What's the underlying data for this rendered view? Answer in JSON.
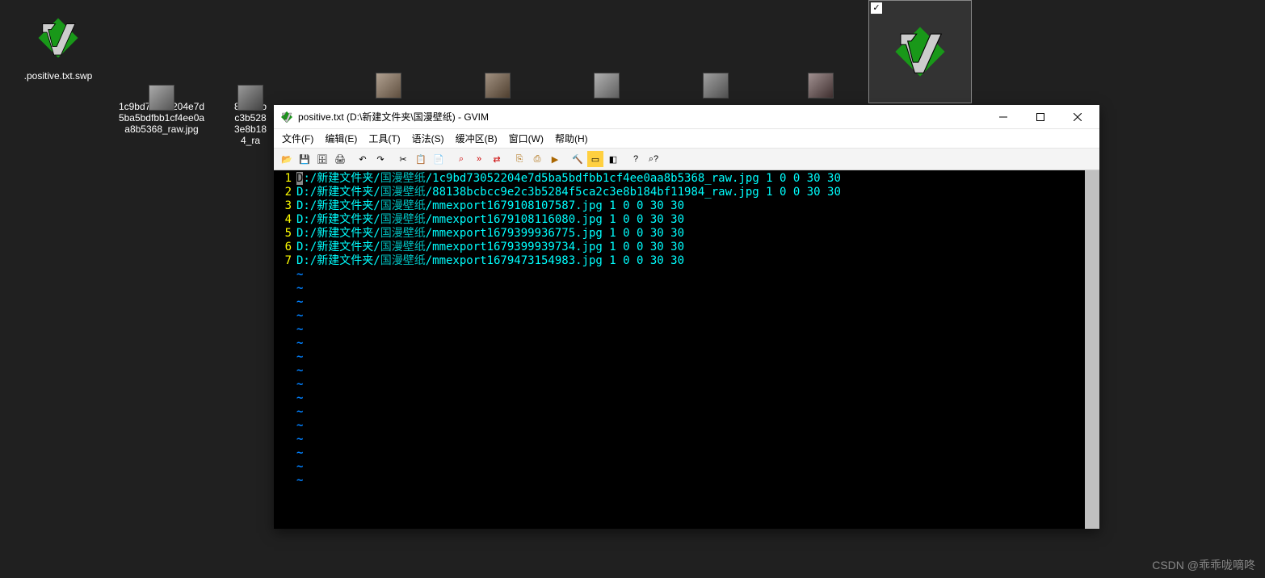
{
  "desktop": {
    "swp_file": ".positive.txt.swp",
    "file1": "1c9bd73052204e7d5ba5bdfbb1cf4ee0aa8b5368_raw.jpg",
    "file2_partial": "88138b\nc3b528\n3e8b18\n4_ra"
  },
  "gvim": {
    "title": "positive.txt (D:\\新建文件夹\\国漫壁纸) - GVIM",
    "menu": {
      "file": "文件(F)",
      "edit": "编辑(E)",
      "tools": "工具(T)",
      "syntax": "语法(S)",
      "buffers": "缓冲区(B)",
      "window": "窗口(W)",
      "help": "帮助(H)"
    },
    "lines": [
      {
        "n": "1",
        "p1": ":/新建文件夹/",
        "p2": "国漫壁纸",
        "p3": "/1c9bd73052204e7d5ba5bdfbb1cf4ee0aa8b5368_raw.jpg 1 0 0 30 30"
      },
      {
        "n": "2",
        "p1": "D:/新建文件夹/",
        "p2": "国漫壁纸",
        "p3": "/88138bcbcc9e2c3b5284f5ca2c3e8b184bf11984_raw.jpg 1 0 0 30 30"
      },
      {
        "n": "3",
        "p1": "D:/新建文件夹/",
        "p2": "国漫壁纸",
        "p3": "/mmexport1679108107587.jpg 1 0 0 30 30"
      },
      {
        "n": "4",
        "p1": "D:/新建文件夹/",
        "p2": "国漫壁纸",
        "p3": "/mmexport1679108116080.jpg 1 0 0 30 30"
      },
      {
        "n": "5",
        "p1": "D:/新建文件夹/",
        "p2": "国漫壁纸",
        "p3": "/mmexport1679399936775.jpg 1 0 0 30 30"
      },
      {
        "n": "6",
        "p1": "D:/新建文件夹/",
        "p2": "国漫壁纸",
        "p3": "/mmexport1679399939734.jpg 1 0 0 30 30"
      },
      {
        "n": "7",
        "p1": "D:/新建文件夹/",
        "p2": "国漫壁纸",
        "p3": "/mmexport1679473154983.jpg 1 0 0 30 30"
      }
    ],
    "cursor_char": "D",
    "tilde": "~"
  },
  "watermark": "CSDN @乖乖咙嘀咚"
}
